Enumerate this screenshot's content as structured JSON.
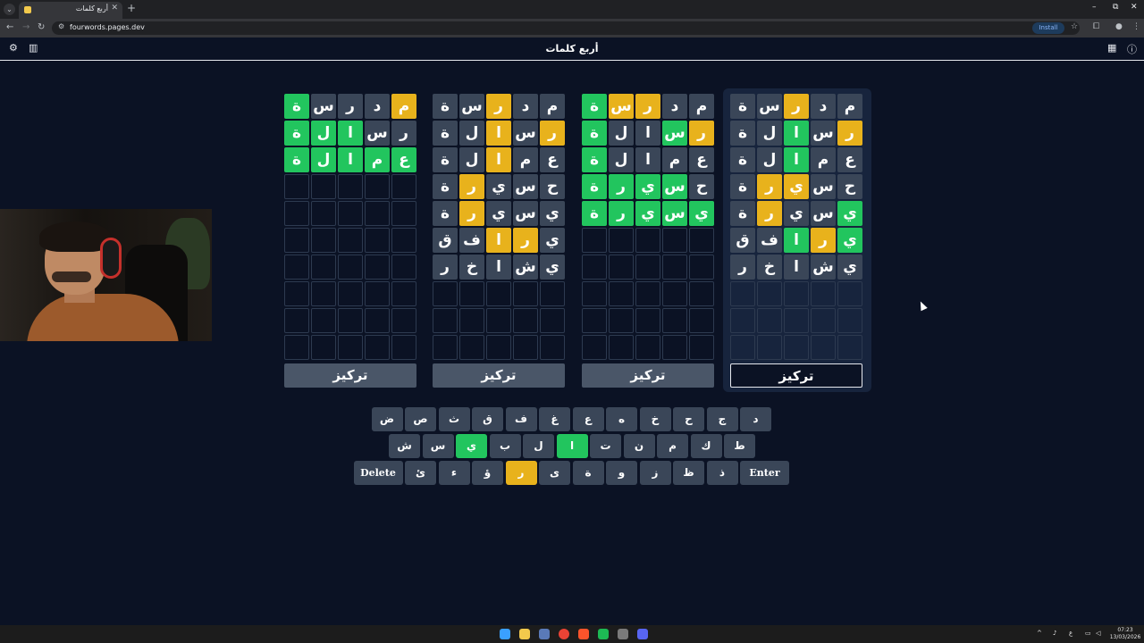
{
  "browser": {
    "tab_title": "أربع كلمات",
    "url": "fourwords.pages.dev",
    "install_label": "Install"
  },
  "app": {
    "title": "أربع كلمات",
    "icons": [
      "settings-icon",
      "stats-icon",
      "calendar-icon",
      "info-icon"
    ]
  },
  "boards": [
    {
      "rows": [
        [
          {
            "l": "م",
            "s": "yellow"
          },
          {
            "l": "د",
            "s": "gray"
          },
          {
            "l": "ر",
            "s": "gray"
          },
          {
            "l": "س",
            "s": "gray"
          },
          {
            "l": "ة",
            "s": "green"
          }
        ],
        [
          {
            "l": "ر",
            "s": "gray"
          },
          {
            "l": "س",
            "s": "gray"
          },
          {
            "l": "ا",
            "s": "green"
          },
          {
            "l": "ل",
            "s": "green"
          },
          {
            "l": "ة",
            "s": "green"
          }
        ],
        [
          {
            "l": "ع",
            "s": "green"
          },
          {
            "l": "م",
            "s": "green"
          },
          {
            "l": "ا",
            "s": "green"
          },
          {
            "l": "ل",
            "s": "green"
          },
          {
            "l": "ة",
            "s": "green"
          }
        ]
      ],
      "focus_label": "تركيز"
    },
    {
      "rows": [
        [
          {
            "l": "م",
            "s": "gray"
          },
          {
            "l": "د",
            "s": "gray"
          },
          {
            "l": "ر",
            "s": "yellow"
          },
          {
            "l": "س",
            "s": "gray"
          },
          {
            "l": "ة",
            "s": "gray"
          }
        ],
        [
          {
            "l": "ر",
            "s": "yellow"
          },
          {
            "l": "س",
            "s": "gray"
          },
          {
            "l": "ا",
            "s": "yellow"
          },
          {
            "l": "ل",
            "s": "gray"
          },
          {
            "l": "ة",
            "s": "gray"
          }
        ],
        [
          {
            "l": "ع",
            "s": "gray"
          },
          {
            "l": "م",
            "s": "gray"
          },
          {
            "l": "ا",
            "s": "yellow"
          },
          {
            "l": "ل",
            "s": "gray"
          },
          {
            "l": "ة",
            "s": "gray"
          }
        ],
        [
          {
            "l": "ح",
            "s": "gray"
          },
          {
            "l": "س",
            "s": "gray"
          },
          {
            "l": "ي",
            "s": "gray"
          },
          {
            "l": "ر",
            "s": "yellow"
          },
          {
            "l": "ة",
            "s": "gray"
          }
        ],
        [
          {
            "l": "ي",
            "s": "gray"
          },
          {
            "l": "س",
            "s": "gray"
          },
          {
            "l": "ي",
            "s": "gray"
          },
          {
            "l": "ر",
            "s": "yellow"
          },
          {
            "l": "ة",
            "s": "gray"
          }
        ],
        [
          {
            "l": "ي",
            "s": "gray"
          },
          {
            "l": "ر",
            "s": "yellow"
          },
          {
            "l": "ا",
            "s": "yellow"
          },
          {
            "l": "ف",
            "s": "gray"
          },
          {
            "l": "ق",
            "s": "gray"
          }
        ],
        [
          {
            "l": "ي",
            "s": "gray"
          },
          {
            "l": "ش",
            "s": "gray"
          },
          {
            "l": "ا",
            "s": "gray"
          },
          {
            "l": "خ",
            "s": "gray"
          },
          {
            "l": "ر",
            "s": "gray"
          }
        ]
      ],
      "focus_label": "تركيز"
    },
    {
      "rows": [
        [
          {
            "l": "م",
            "s": "gray"
          },
          {
            "l": "د",
            "s": "gray"
          },
          {
            "l": "ر",
            "s": "yellow"
          },
          {
            "l": "س",
            "s": "yellow"
          },
          {
            "l": "ة",
            "s": "green"
          }
        ],
        [
          {
            "l": "ر",
            "s": "yellow"
          },
          {
            "l": "س",
            "s": "green"
          },
          {
            "l": "ا",
            "s": "gray"
          },
          {
            "l": "ل",
            "s": "gray"
          },
          {
            "l": "ة",
            "s": "green"
          }
        ],
        [
          {
            "l": "ع",
            "s": "gray"
          },
          {
            "l": "م",
            "s": "gray"
          },
          {
            "l": "ا",
            "s": "gray"
          },
          {
            "l": "ل",
            "s": "gray"
          },
          {
            "l": "ة",
            "s": "green"
          }
        ],
        [
          {
            "l": "ح",
            "s": "gray"
          },
          {
            "l": "س",
            "s": "green"
          },
          {
            "l": "ي",
            "s": "green"
          },
          {
            "l": "ر",
            "s": "green"
          },
          {
            "l": "ة",
            "s": "green"
          }
        ],
        [
          {
            "l": "ي",
            "s": "green"
          },
          {
            "l": "س",
            "s": "green"
          },
          {
            "l": "ي",
            "s": "green"
          },
          {
            "l": "ر",
            "s": "green"
          },
          {
            "l": "ة",
            "s": "green"
          }
        ]
      ],
      "focus_label": "تركيز"
    },
    {
      "rows": [
        [
          {
            "l": "م",
            "s": "gray"
          },
          {
            "l": "د",
            "s": "gray"
          },
          {
            "l": "ر",
            "s": "yellow"
          },
          {
            "l": "س",
            "s": "gray"
          },
          {
            "l": "ة",
            "s": "gray"
          }
        ],
        [
          {
            "l": "ر",
            "s": "yellow"
          },
          {
            "l": "س",
            "s": "gray"
          },
          {
            "l": "ا",
            "s": "green"
          },
          {
            "l": "ل",
            "s": "gray"
          },
          {
            "l": "ة",
            "s": "gray"
          }
        ],
        [
          {
            "l": "ع",
            "s": "gray"
          },
          {
            "l": "م",
            "s": "gray"
          },
          {
            "l": "ا",
            "s": "green"
          },
          {
            "l": "ل",
            "s": "gray"
          },
          {
            "l": "ة",
            "s": "gray"
          }
        ],
        [
          {
            "l": "ح",
            "s": "gray"
          },
          {
            "l": "س",
            "s": "gray"
          },
          {
            "l": "ي",
            "s": "yellow"
          },
          {
            "l": "ر",
            "s": "yellow"
          },
          {
            "l": "ة",
            "s": "gray"
          }
        ],
        [
          {
            "l": "ي",
            "s": "green"
          },
          {
            "l": "س",
            "s": "gray"
          },
          {
            "l": "ي",
            "s": "gray"
          },
          {
            "l": "ر",
            "s": "yellow"
          },
          {
            "l": "ة",
            "s": "gray"
          }
        ],
        [
          {
            "l": "ي",
            "s": "green"
          },
          {
            "l": "ر",
            "s": "yellow"
          },
          {
            "l": "ا",
            "s": "green"
          },
          {
            "l": "ف",
            "s": "gray"
          },
          {
            "l": "ق",
            "s": "gray"
          }
        ],
        [
          {
            "l": "ي",
            "s": "gray"
          },
          {
            "l": "ش",
            "s": "gray"
          },
          {
            "l": "ا",
            "s": "gray"
          },
          {
            "l": "خ",
            "s": "gray"
          },
          {
            "l": "ر",
            "s": "gray"
          }
        ]
      ],
      "focus_label": "تركيز",
      "active": true
    }
  ],
  "keyboard": {
    "row1": [
      {
        "k": "د"
      },
      {
        "k": "ج"
      },
      {
        "k": "ح"
      },
      {
        "k": "خ"
      },
      {
        "k": "ه"
      },
      {
        "k": "ع"
      },
      {
        "k": "غ"
      },
      {
        "k": "ف"
      },
      {
        "k": "ق"
      },
      {
        "k": "ث"
      },
      {
        "k": "ص"
      },
      {
        "k": "ض"
      }
    ],
    "row2": [
      {
        "k": "ط"
      },
      {
        "k": "ك"
      },
      {
        "k": "م"
      },
      {
        "k": "ن"
      },
      {
        "k": "ت"
      },
      {
        "k": "ا",
        "s": "green"
      },
      {
        "k": "ل"
      },
      {
        "k": "ب"
      },
      {
        "k": "ي",
        "s": "green"
      },
      {
        "k": "س"
      },
      {
        "k": "ش"
      }
    ],
    "row3": [
      {
        "k": "Enter",
        "wide": true
      },
      {
        "k": "ذ"
      },
      {
        "k": "ظ"
      },
      {
        "k": "ز"
      },
      {
        "k": "و"
      },
      {
        "k": "ة"
      },
      {
        "k": "ى"
      },
      {
        "k": "ر",
        "s": "yellow"
      },
      {
        "k": "ؤ"
      },
      {
        "k": "ء"
      },
      {
        "k": "ئ"
      },
      {
        "k": "Delete",
        "wide": true
      }
    ]
  },
  "taskbar": {
    "clock_time": "07:23",
    "clock_date": "13/03/2026",
    "lang": "ع"
  }
}
